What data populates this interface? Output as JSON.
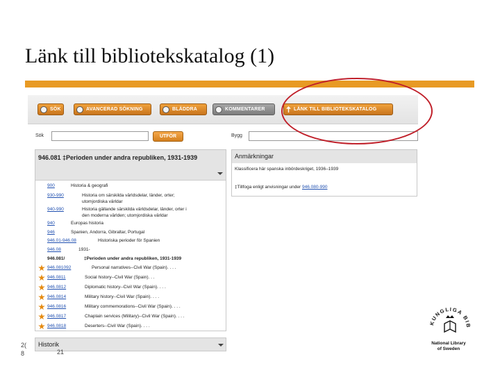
{
  "slide": {
    "title": "Länk till bibliotekskatalog (1)",
    "footer_left_1": "2(",
    "footer_left_2": "8",
    "footer_page": "21"
  },
  "colors": {
    "accent_bar": "#e89a24",
    "callout": "#c0202a",
    "link": "#1f4fb0"
  },
  "toolbar": {
    "buttons": [
      {
        "label": "SÖK",
        "icon": "search-icon"
      },
      {
        "label": "AVANCERAD SÖKNING",
        "icon": "search-icon"
      },
      {
        "label": "BLÄDDRA",
        "icon": "camera-icon"
      },
      {
        "label": "KOMMENTARER",
        "icon": "circle-icon"
      },
      {
        "label": "LÄNK TILL BIBLIOTEKSKATALOG",
        "icon": "pin-icon"
      }
    ]
  },
  "search": {
    "sok_label": "Sök",
    "go_label": "UTFÖR",
    "bygg_label": "Bygg"
  },
  "entry": {
    "heading": "946.081 ‡Perioden under andra republiken, 1931-1939",
    "hierarchy": [
      {
        "code": "900",
        "text": "Historia & geografi"
      },
      {
        "code": "930-990",
        "text": "Historia om särskilda världsdelar, länder, orter;"
      },
      {
        "code": "",
        "text": "utomjordiska världar"
      },
      {
        "code": "940-990",
        "text": "Historia gällande särskilda världsdelar, länder, orter i"
      },
      {
        "code": "",
        "text": "den moderna världen; utomjordiska världar"
      },
      {
        "code": "940",
        "text": "Europas historia"
      },
      {
        "code": "946",
        "text": "Spanien, Andorra, Gibraltar, Portugal"
      },
      {
        "code": "946.01-946.08",
        "text": "Historiska perioder för Spanien"
      },
      {
        "code": "946.08",
        "text": "1931-"
      }
    ],
    "current": {
      "code": "946.081/",
      "text": "‡Perioden under andra republiken, 1931-1939"
    },
    "subjects": [
      {
        "code": "946.081092",
        "text": "Personal narratives--Civil War (Spain). . . ."
      },
      {
        "code": "946.0811",
        "text": "Social history--Civil War (Spain). . ."
      },
      {
        "code": "946.0812",
        "text": "Diplomatic history--Civil War (Spain). . . ."
      },
      {
        "code": "946.0814",
        "text": "Military history--Civil War (Spain). . . ."
      },
      {
        "code": "946.0816",
        "text": "Military commemorations--Civil War (Spain). . . ."
      },
      {
        "code": "946.0817",
        "text": "Chaplain services (Military)--Civil War (Spain). . . ."
      },
      {
        "code": "946.0818",
        "text": "Deserters--Civil War (Spain). . . ."
      }
    ]
  },
  "notes": {
    "heading": "Anmärkningar",
    "line1": "Klassificera här spanska inbördeskriget, 1936–1939",
    "line2_prefix": "‡Tillfoga enligt anvisningar under ",
    "line2_link": "946.080-990"
  },
  "history": {
    "label": "Historik"
  },
  "logo": {
    "seal_text": "KUNGLIGA BIBLIOTEKET",
    "line1": "National Library",
    "line2": "of Sweden"
  }
}
